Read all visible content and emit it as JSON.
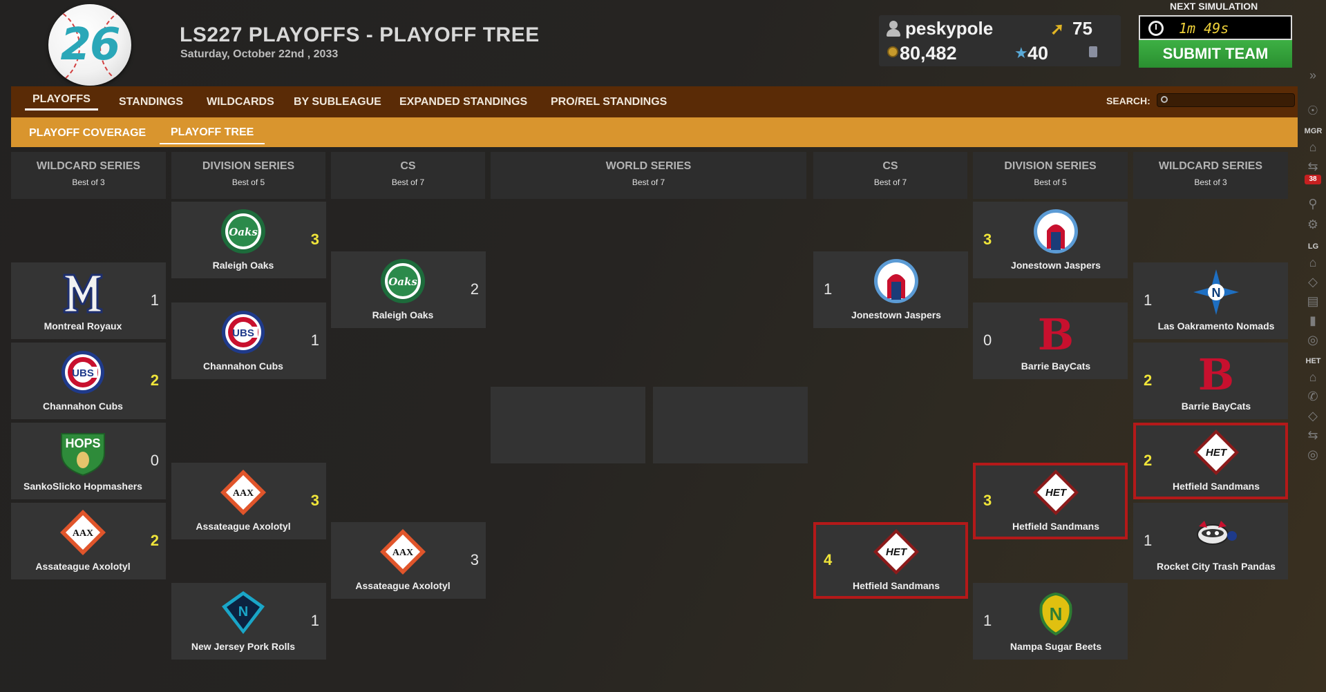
{
  "header": {
    "logo_number": "26",
    "title": "LS227 PLAYOFFS - PLAYOFF TREE",
    "date": "Saturday, October 22nd , 2033"
  },
  "user": {
    "name": "peskypole",
    "coins": "80,482",
    "arrow_value": "75",
    "star_value": "40"
  },
  "simulation": {
    "label": "NEXT SIMULATION",
    "time": "1m 49s",
    "submit_label": "SUBMIT TEAM"
  },
  "nav": {
    "main_tabs": [
      {
        "label": "PLAYOFFS",
        "active": true
      },
      {
        "label": "STANDINGS"
      },
      {
        "label": "WILDCARDS"
      },
      {
        "label": "BY SUBLEAGUE"
      },
      {
        "label": "EXPANDED STANDINGS"
      },
      {
        "label": "PRO/REL STANDINGS"
      }
    ],
    "search_label": "SEARCH:",
    "search_placeholder": "",
    "sub_tabs": [
      {
        "label": "PLAYOFF COVERAGE"
      },
      {
        "label": "PLAYOFF TREE",
        "active": true
      }
    ]
  },
  "rail": {
    "mgr_label": "MGR",
    "lg_label": "LG",
    "het_label": "HET",
    "badge": "38"
  },
  "columns": [
    {
      "title": "WILDCARD SERIES",
      "subtitle": "Best of 3"
    },
    {
      "title": "DIVISION SERIES",
      "subtitle": "Best of 5"
    },
    {
      "title": "CS",
      "subtitle": "Best of 7"
    },
    {
      "title": "WORLD SERIES",
      "subtitle": "Best of 7"
    },
    {
      "title": "CS",
      "subtitle": "Best of 7"
    },
    {
      "title": "DIVISION SERIES",
      "subtitle": "Best of 5"
    },
    {
      "title": "WILDCARD SERIES",
      "subtitle": "Best of 3"
    }
  ],
  "bracket": {
    "left_wildcard": [
      {
        "team": "Montreal Royaux",
        "score": "1",
        "winner": false,
        "logo": "montreal-m-logo"
      },
      {
        "team": "Channahon Cubs",
        "score": "2",
        "winner": true,
        "logo": "cubs-logo"
      },
      {
        "team": "SankoSlicko Hopmashers",
        "score": "0",
        "winner": false,
        "logo": "hops-logo"
      },
      {
        "team": "Assateague Axolotyl",
        "score": "2",
        "winner": true,
        "logo": "aax-logo"
      }
    ],
    "left_division": [
      {
        "team": "Raleigh Oaks",
        "score": "3",
        "winner": true,
        "logo": "oaks-logo"
      },
      {
        "team": "Channahon Cubs",
        "score": "1",
        "winner": false,
        "logo": "cubs-logo"
      },
      {
        "team": "Assateague Axolotyl",
        "score": "3",
        "winner": true,
        "logo": "aax-logo"
      },
      {
        "team": "New Jersey Pork Rolls",
        "score": "1",
        "winner": false,
        "logo": "nj-logo"
      }
    ],
    "left_cs": [
      {
        "team": "Raleigh Oaks",
        "score": "2",
        "winner": false,
        "logo": "oaks-logo"
      },
      {
        "team": "Assateague Axolotyl",
        "score": "3",
        "winner": false,
        "logo": "aax-logo"
      }
    ],
    "right_cs": [
      {
        "team": "Jonestown Jaspers",
        "score": "1",
        "winner": false,
        "logo": "jaspers-logo"
      },
      {
        "team": "Hetfield Sandmans",
        "score": "4",
        "winner": true,
        "logo": "het-logo"
      }
    ],
    "right_division": [
      {
        "team": "Jonestown Jaspers",
        "score": "3",
        "winner": true,
        "logo": "jaspers-logo"
      },
      {
        "team": "Barrie BayCats",
        "score": "0",
        "winner": false,
        "logo": "baycats-logo"
      },
      {
        "team": "Hetfield Sandmans",
        "score": "3",
        "winner": true,
        "logo": "het-logo"
      },
      {
        "team": "Nampa Sugar Beets",
        "score": "1",
        "winner": false,
        "logo": "nampa-logo"
      }
    ],
    "right_wildcard": [
      {
        "team": "Las Oakramento Nomads",
        "score": "1",
        "winner": false,
        "logo": "nomads-logo"
      },
      {
        "team": "Barrie BayCats",
        "score": "2",
        "winner": true,
        "logo": "baycats-logo"
      },
      {
        "team": "Hetfield Sandmans",
        "score": "2",
        "winner": true,
        "logo": "het-logo"
      },
      {
        "team": "Rocket City Trash Pandas",
        "score": "1",
        "winner": false,
        "logo": "trash-pandas-logo"
      }
    ]
  },
  "colors": {
    "nav_main_bg": "#5a2b06",
    "nav_sub_bg": "#d9952e",
    "card_bg": "#343434",
    "winner_score": "#f0e53a",
    "highlight_border": "#b41919",
    "submit_green": "#3db044",
    "timer_text": "#f0d23a"
  }
}
